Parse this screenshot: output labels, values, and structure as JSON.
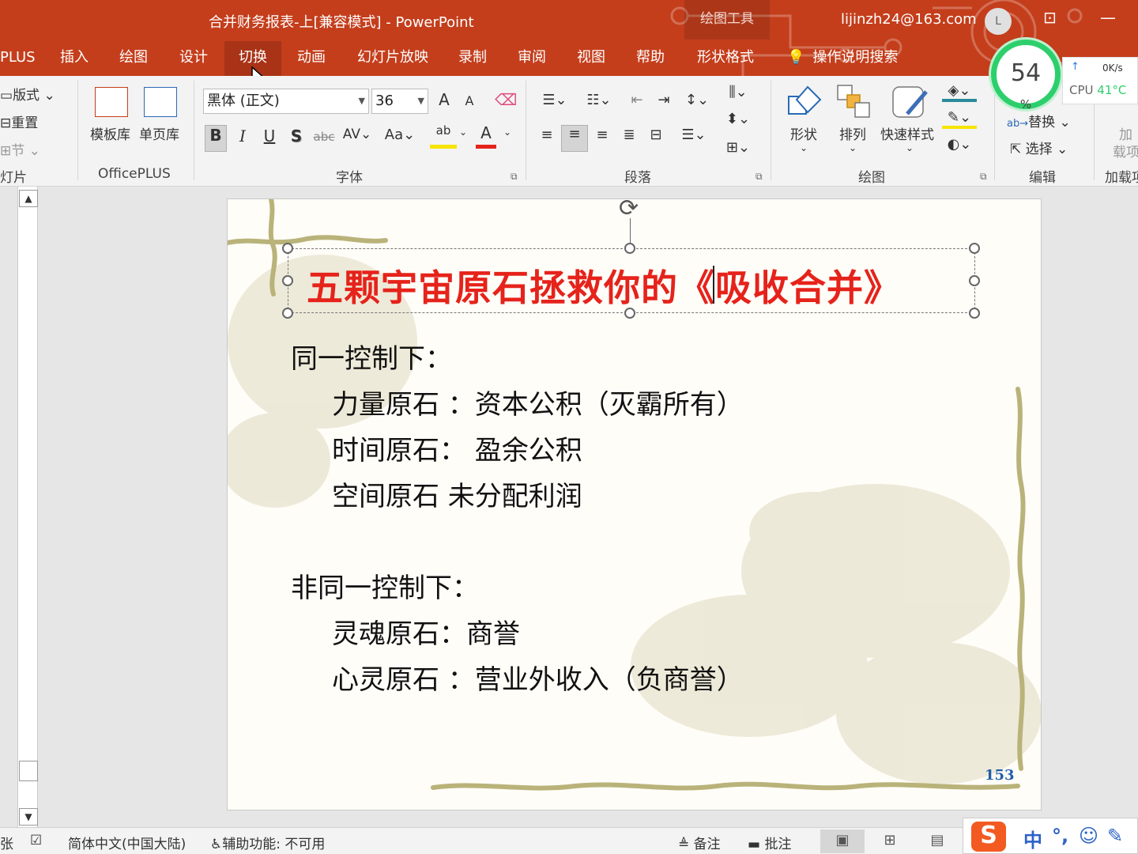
{
  "window": {
    "title": "合并财务报表-上[兼容模式]  -  PowerPoint",
    "context_tab": "绘图工具",
    "user_email": "lijinzh24@163.com",
    "avatar_letter": "L"
  },
  "tabs": [
    {
      "label": "PLUS"
    },
    {
      "label": "插入"
    },
    {
      "label": "绘图"
    },
    {
      "label": "设计"
    },
    {
      "label": "切换",
      "active": true
    },
    {
      "label": "动画"
    },
    {
      "label": "幻灯片放映"
    },
    {
      "label": "录制"
    },
    {
      "label": "审阅"
    },
    {
      "label": "视图"
    },
    {
      "label": "帮助"
    },
    {
      "label": "形状格式"
    }
  ],
  "tell_me": "操作说明搜索",
  "perf": {
    "percent": "54",
    "percent_unit": "%",
    "net": "0K/s",
    "cpu_label": "CPU",
    "cpu_temp": "41°C"
  },
  "ribbon": {
    "slides_group": {
      "layout": "版式",
      "reset": "重置",
      "section": "节",
      "label": "灯片"
    },
    "officeplus": {
      "template": "模板库",
      "single": "单页库",
      "label": "OfficePLUS"
    },
    "font": {
      "name": "黑体 (正文)",
      "size": "36",
      "label": "字体",
      "bold": "B",
      "italic": "I",
      "underline": "U",
      "shadow": "S",
      "strike": "abc",
      "spacing": "AV",
      "case": "Aa",
      "grow": "A",
      "shrink": "A"
    },
    "paragraph": {
      "label": "段落"
    },
    "drawing": {
      "shape": "形状",
      "arrange": "排列",
      "quick_styles": "快速样式",
      "label": "绘图"
    },
    "editing": {
      "replace": "替换",
      "select": "选择",
      "label": "编辑"
    },
    "addins": {
      "line1": "加",
      "line2": "载项",
      "label": "加载项"
    }
  },
  "slide": {
    "title": "五颗宇宙原石拯救你的《吸收合并》",
    "lines": [
      "同一控制下：",
      "力量原石 ：资本公积（灭霸所有）",
      "时间原石：  盈余公积",
      "空间原石     未分配利润",
      "非同一控制下：",
      "灵魂原石：商誉",
      "心灵原石 ：营业外收入（负商誉）"
    ],
    "page_number": "153"
  },
  "status": {
    "language": "简体中文(中国大陆)",
    "accessibility": "辅助功能: 不可用",
    "notes": "备注",
    "comments": "批注",
    "left_fragment": "张"
  },
  "ime": {
    "logo": "S",
    "mode": "中"
  }
}
